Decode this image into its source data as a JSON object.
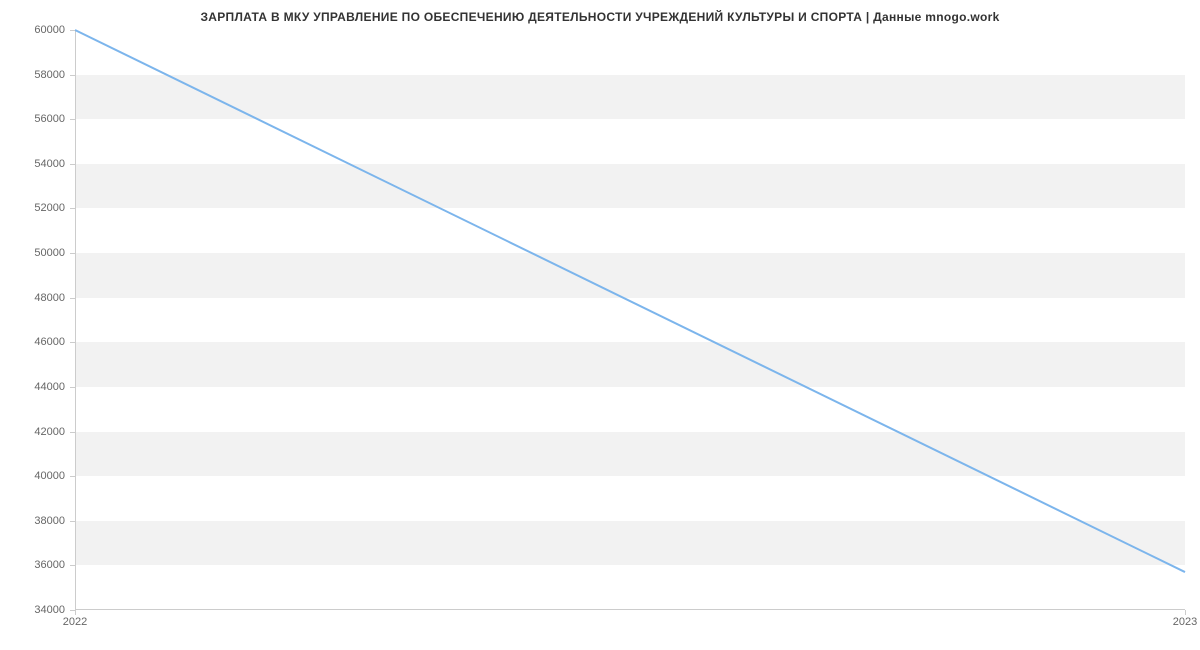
{
  "chart_data": {
    "type": "line",
    "title": "ЗАРПЛАТА В МКУ УПРАВЛЕНИЕ ПО ОБЕСПЕЧЕНИЮ ДЕЯТЕЛЬНОСТИ УЧРЕЖДЕНИЙ КУЛЬТУРЫ И СПОРТА | Данные mnogo.work",
    "x": [
      "2022",
      "2023"
    ],
    "values": [
      60000,
      35700
    ],
    "xlabel": "",
    "ylabel": "",
    "ylim": [
      34000,
      60000
    ],
    "yticks": [
      34000,
      36000,
      38000,
      40000,
      42000,
      44000,
      46000,
      48000,
      50000,
      52000,
      54000,
      56000,
      58000,
      60000
    ],
    "xticks": [
      "2022",
      "2023"
    ],
    "line_color": "#7cb5ec"
  }
}
